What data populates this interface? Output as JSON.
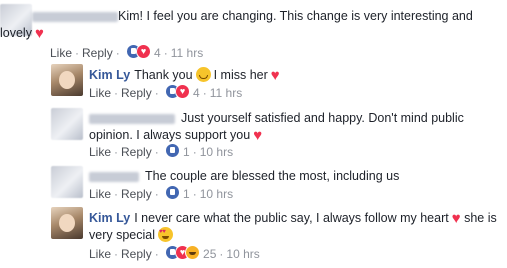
{
  "actions": {
    "like": "Like",
    "reply": "Reply",
    "sep": "·"
  },
  "comments": [
    {
      "text_part1": "Kim! I feel you are changing. This change is very interesting and lovely",
      "reactions": "4",
      "time": "11 hrs",
      "reaction_icons": [
        "like-icon",
        "love-icon"
      ]
    },
    {
      "author": "Kim Ly",
      "text_part1": "Thank you",
      "text_part2": "I miss her",
      "reactions": "4",
      "time": "11 hrs",
      "reaction_icons": [
        "like-icon",
        "love-icon"
      ]
    },
    {
      "text_part1": "Just yourself satisfied and happy. Don't mind public opinion. I always support you",
      "reactions": "1",
      "time": "10 hrs",
      "reaction_icons": [
        "like-icon"
      ]
    },
    {
      "text_part1": "The couple are blessed the most, including us",
      "reactions": "1",
      "time": "10 hrs",
      "reaction_icons": [
        "like-icon"
      ]
    },
    {
      "author": "Kim Ly",
      "text_part1": "I never care what the public say, I always follow my heart",
      "text_part2": "she is very special",
      "reactions": "25",
      "time": "10 hrs",
      "reaction_icons": [
        "like-icon",
        "love-icon",
        "haha-icon"
      ]
    }
  ],
  "colors": {
    "link": "#365899",
    "meta": "#90949c",
    "love": "#f0314f",
    "like": "#4267b2"
  }
}
